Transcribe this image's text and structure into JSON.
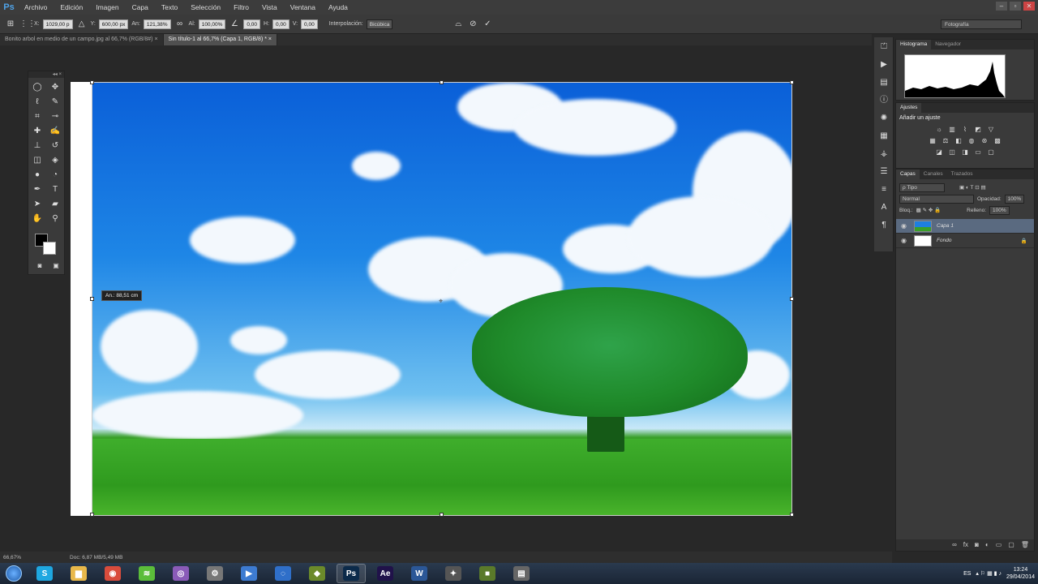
{
  "app": {
    "logo": "Ps"
  },
  "menu": [
    "Archivo",
    "Edición",
    "Imagen",
    "Capa",
    "Texto",
    "Selección",
    "Filtro",
    "Vista",
    "Ventana",
    "Ayuda"
  ],
  "window_buttons": [
    "–",
    "▫",
    "✕"
  ],
  "options": {
    "x_label": "X:",
    "x_value": "1029,00 p",
    "y_label": "Y:",
    "y_value": "600,00 px",
    "w_label": "An:",
    "w_value": "121,38%",
    "h_label": "Al:",
    "h_value": "100,00%",
    "angle_value": "0,00",
    "hskew_label": "H:",
    "hskew_value": "0,00",
    "vskew_label": "V:",
    "vskew_value": "0,00",
    "interp_label": "Interpolación:",
    "interp_value": "Bicúbica",
    "workspace": "Fotografía"
  },
  "tabs": [
    {
      "label": "Bonito arbol en medio de un campo.jpg al 66,7% (RGB/8#)",
      "close": "×"
    },
    {
      "label": "Sin título-1 al 66,7% (Capa 1, RGB/8) *",
      "close": "×"
    }
  ],
  "canvas": {
    "tooltip": "An.: 88,51 cm"
  },
  "status": {
    "zoom": "66,67%",
    "doc": "Doc: 6,87 MB/5,49 MB"
  },
  "panels": {
    "histogram_tabs": [
      "Histograma",
      "Navegador"
    ],
    "adjust_tab": "Ajustes",
    "adjust_title": "Añadir un ajuste",
    "layers_tabs": [
      "Capas",
      "Canales",
      "Trazados"
    ],
    "filter_kind": "ρ Tipo",
    "blend_mode": "Normal",
    "opacity_label": "Opacidad:",
    "opacity_value": "100%",
    "lock_label": "Bloq.:",
    "fill_label": "Relleno:",
    "fill_value": "100%",
    "layers": [
      {
        "name": "Capa 1",
        "selected": true
      },
      {
        "name": "Fondo",
        "selected": false,
        "locked": true
      }
    ]
  },
  "taskbar": {
    "lang": "ES",
    "time": "13:24",
    "date": "29/04/2014",
    "apps": [
      {
        "name": "skype-icon",
        "glyph": "S",
        "color": "#1ea7e1"
      },
      {
        "name": "explorer-icon",
        "glyph": "▆",
        "color": "#e8b84a"
      },
      {
        "name": "chrome-icon",
        "glyph": "◉",
        "color": "#d94c3c"
      },
      {
        "name": "spotify-icon",
        "glyph": "≋",
        "color": "#5bbd3a"
      },
      {
        "name": "app-purple-icon",
        "glyph": "◎",
        "color": "#8a5bb8"
      },
      {
        "name": "app-gear-icon",
        "glyph": "⚙",
        "color": "#777"
      },
      {
        "name": "media-player-icon",
        "glyph": "▶",
        "color": "#3d7bd1"
      },
      {
        "name": "app-red-icon",
        "glyph": "◌",
        "color": "#2f6fc9"
      },
      {
        "name": "app-green-icon",
        "glyph": "◆",
        "color": "#6b8a2a"
      },
      {
        "name": "photoshop-icon",
        "glyph": "Ps",
        "color": "#0b2a4a",
        "active": true
      },
      {
        "name": "after-effects-icon",
        "glyph": "Ae",
        "color": "#20124a"
      },
      {
        "name": "word-icon",
        "glyph": "W",
        "color": "#2b5797"
      },
      {
        "name": "app-tools-icon",
        "glyph": "✦",
        "color": "#555"
      },
      {
        "name": "minecraft-icon",
        "glyph": "■",
        "color": "#5a7a2a"
      },
      {
        "name": "app-window-icon",
        "glyph": "▤",
        "color": "#666"
      }
    ]
  }
}
